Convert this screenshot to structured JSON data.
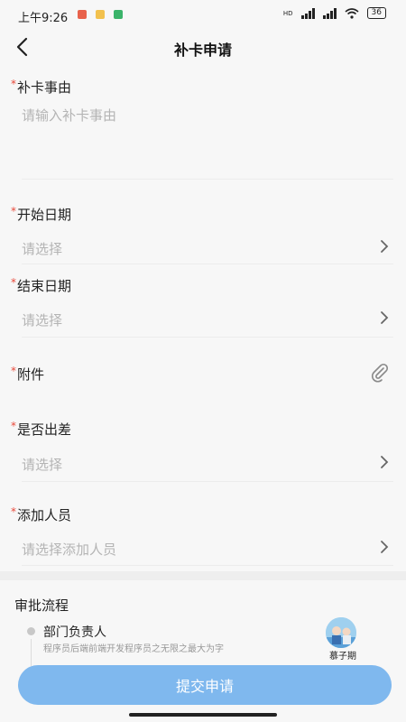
{
  "status": {
    "time": "上午9:26",
    "battery": "36",
    "hd": "HD"
  },
  "header": {
    "title": "补卡申请"
  },
  "form": {
    "required_mark": "*",
    "reason": {
      "label": "补卡事由",
      "placeholder": "请输入补卡事由"
    },
    "start_date": {
      "label": "开始日期",
      "placeholder": "请选择"
    },
    "end_date": {
      "label": "结束日期",
      "placeholder": "请选择"
    },
    "attachment": {
      "label": "附件"
    },
    "business_trip": {
      "label": "是否出差",
      "placeholder": "请选择"
    },
    "add_people": {
      "label": "添加人员",
      "placeholder": "请选择添加人员"
    }
  },
  "approval": {
    "title": "审批流程",
    "steps": [
      {
        "role": "部门负责人",
        "desc": "程序员后端前端开发程序员之无限之最大为字",
        "approver": "慕子期"
      }
    ]
  },
  "submit_label": "提交申请",
  "colors": {
    "accent": "#7fb8ee",
    "required": "#e8493a",
    "placeholder": "#b4b4b4"
  },
  "icons": [
    "back-arrow-icon",
    "chevron-right-icon",
    "paperclip-icon",
    "wifi-icon",
    "signal-icon",
    "battery-icon"
  ]
}
